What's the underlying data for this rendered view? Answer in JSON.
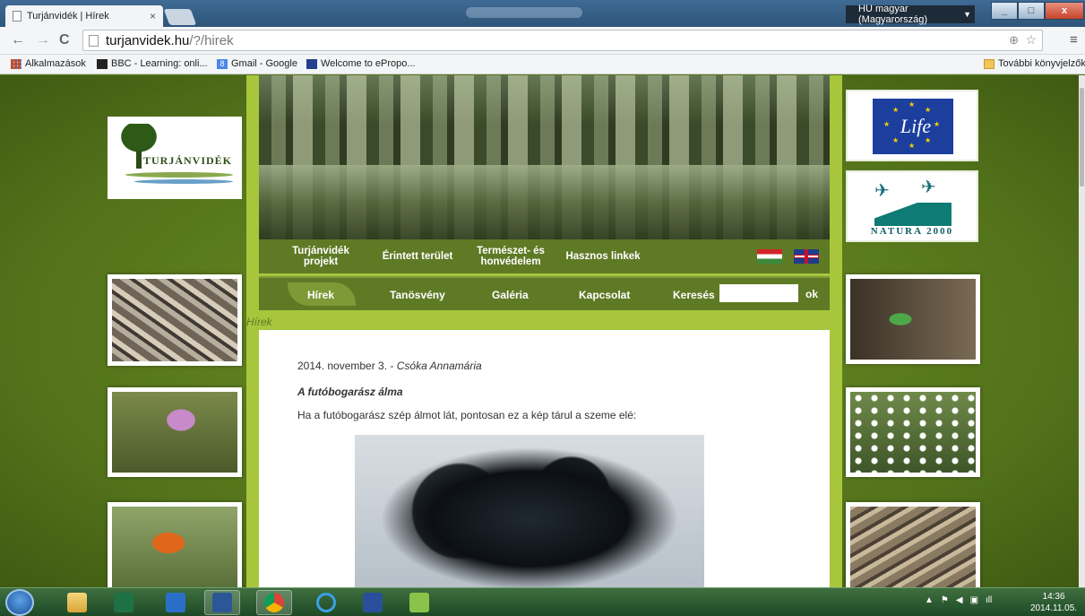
{
  "browser": {
    "tab_title": "Turjánvidék | Hírek",
    "tab_close": "×",
    "ime_indicator": "HU magyar (Magyarország)",
    "window_buttons": {
      "minimize": "_",
      "maximize": "□",
      "close": "x"
    },
    "url_host": "turjanvidek.hu",
    "url_path": "/?/hirek",
    "nav": {
      "back": "←",
      "forward": "→",
      "reload": "C"
    },
    "menu": "≡",
    "bookmarks": [
      {
        "label": "Alkalmazások",
        "icon": "apps-grid-icon"
      },
      {
        "label": "BBC - Learning: onli...",
        "icon": "bbc-icon"
      },
      {
        "label": "Gmail - Google",
        "icon": "google-icon"
      },
      {
        "label": "Welcome to ePropo...",
        "icon": "epropo-icon"
      }
    ],
    "other_bookmarks": "További könyvjelzők"
  },
  "site": {
    "logo_text": "TURJÁNVIDÉK",
    "life_logo": "Life",
    "natura_logo": "NATURA 2000",
    "nav_primary": [
      {
        "line1": "Turjánvidék",
        "line2": "projekt"
      },
      {
        "line1": "Érintett terület",
        "line2": ""
      },
      {
        "line1": "Természet- és",
        "line2": "honvédelem"
      },
      {
        "line1": "Hasznos linkek",
        "line2": ""
      }
    ],
    "nav_secondary": [
      "Hírek",
      "Tanösvény",
      "Galéria",
      "Kapcsolat"
    ],
    "search_label": "Keresés",
    "search_value": "",
    "search_button": "ok",
    "breadcrumb": "Hírek"
  },
  "post": {
    "date": "2014. november 3.",
    "separator": " - ",
    "author": "Csóka Annamária",
    "title": "A futóbogarász álma",
    "body": "Ha a futóbogarász szép álmot lát, pontosan ez a kép tárul a szeme elé:"
  },
  "taskbar": {
    "apps": [
      "file-explorer-icon",
      "excel-icon",
      "media-player-icon",
      "word-icon",
      "chrome-icon",
      "internet-explorer-icon",
      "save-disk-icon",
      "qgis-icon"
    ],
    "time": "14:36",
    "date": "2014.11.05."
  },
  "colors": {
    "site_bg": "#5a7a1e",
    "column_bg": "#a7c63c",
    "nav_bg": "#5f7a25"
  }
}
